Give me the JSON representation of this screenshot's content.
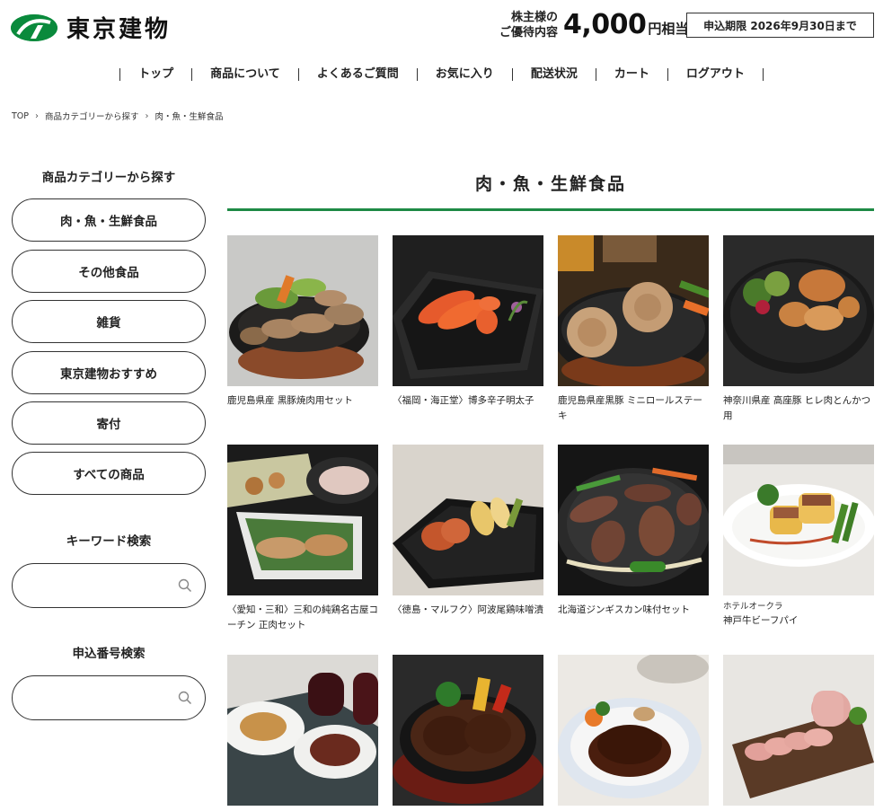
{
  "header": {
    "logo_text": "東京建物",
    "benefit_label_line1": "株主様の",
    "benefit_label_line2": "ご優待内容",
    "benefit_amount": "4,000",
    "benefit_unit": "円相当",
    "deadline": "申込期限 2026年9月30日まで"
  },
  "nav": {
    "items": [
      "トップ",
      "商品について",
      "よくあるご質問",
      "お気に入り",
      "配送状況",
      "カート",
      "ログアウト"
    ]
  },
  "breadcrumb": {
    "items": [
      "TOP",
      "商品カテゴリーから探す",
      "肉・魚・生鮮食品"
    ]
  },
  "sidebar": {
    "category_heading": "商品カテゴリーから探す",
    "categories": [
      "肉・魚・生鮮食品",
      "その他食品",
      "雑貨",
      "東京建物おすすめ",
      "寄付",
      "すべての商品"
    ],
    "keyword_heading": "キーワード検索",
    "keyword_placeholder": "",
    "number_heading": "申込番号検索",
    "number_placeholder": ""
  },
  "main": {
    "title": "肉・魚・生鮮食品",
    "products": [
      {
        "brand": "",
        "name": "鹿児島県産 黒豚焼肉用セット"
      },
      {
        "brand": "",
        "name": "〈福岡・海正堂〉博多辛子明太子"
      },
      {
        "brand": "",
        "name": "鹿児島県産黒豚 ミニロールステーキ"
      },
      {
        "brand": "",
        "name": "神奈川県産 高座豚 ヒレ肉とんかつ用"
      },
      {
        "brand": "",
        "name": "〈愛知・三和〉三和の純鶏名古屋コーチン 正肉セット"
      },
      {
        "brand": "",
        "name": "〈徳島・マルフク〉阿波尾鶏味噌漬"
      },
      {
        "brand": "",
        "name": "北海道ジンギスカン味付セット"
      },
      {
        "brand": "ホテルオークラ",
        "name": "神戸牛ビーフパイ"
      },
      {
        "brand": "",
        "name": ""
      },
      {
        "brand": "",
        "name": ""
      },
      {
        "brand": "",
        "name": ""
      },
      {
        "brand": "",
        "name": ""
      }
    ]
  },
  "colors": {
    "brand_green": "#1e8a45",
    "logo_green": "#0a8a3c"
  }
}
